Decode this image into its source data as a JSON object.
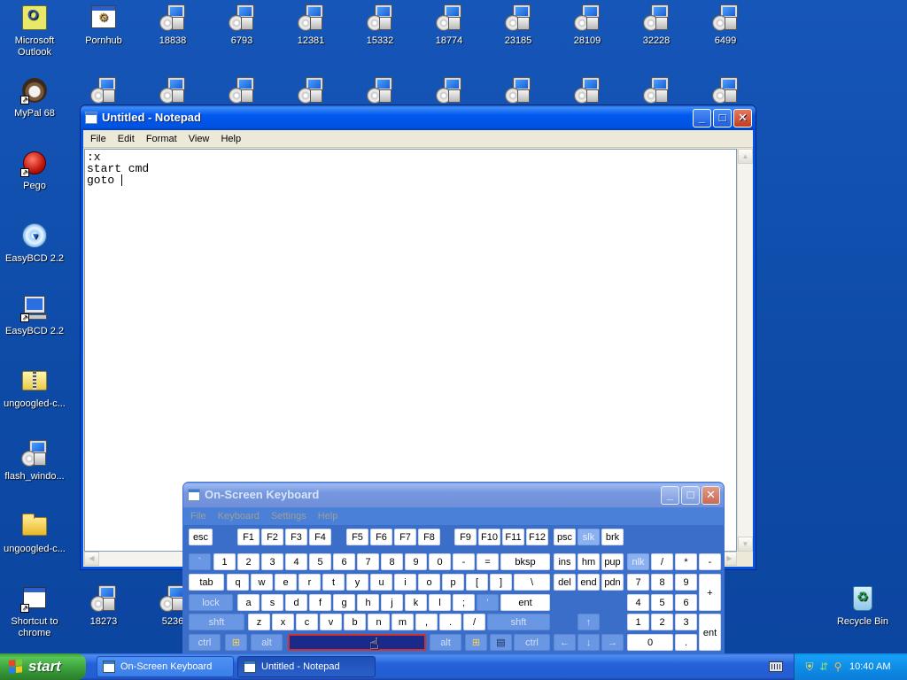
{
  "desktop": {
    "icons_top_row": [
      {
        "label": "Microsoft Outlook",
        "line1": "Microsoft",
        "line2": "Outlook",
        "icon": "outlook-icon"
      },
      {
        "label": "Pornhub",
        "icon": "application-icon"
      },
      {
        "label": "18838",
        "icon": "installer-icon"
      },
      {
        "label": "6793",
        "icon": "installer-icon"
      },
      {
        "label": "12381",
        "icon": "installer-icon"
      },
      {
        "label": "15332",
        "icon": "installer-icon"
      },
      {
        "label": "18774",
        "icon": "installer-icon"
      },
      {
        "label": "23185",
        "icon": "installer-icon"
      },
      {
        "label": "28109",
        "icon": "installer-icon"
      },
      {
        "label": "32228",
        "icon": "installer-icon"
      },
      {
        "label": "6499",
        "icon": "installer-icon"
      }
    ],
    "icons_left_column": [
      {
        "label": "MyPal 68",
        "icon": "mypal-icon"
      },
      {
        "label": "Pego",
        "icon": "pego-icon"
      },
      {
        "label": "EasyBCD 2.2",
        "icon": "easybcd-icon"
      },
      {
        "label": "EasyBCD 2.2",
        "icon": "easybcd-installer-icon"
      },
      {
        "label": "ungoogled-c...",
        "icon": "zip-folder-icon"
      },
      {
        "label": "flash_windo...",
        "icon": "installer-icon"
      },
      {
        "label": "ungoogled-c...",
        "icon": "folder-icon"
      }
    ],
    "icons_bottom_row": [
      {
        "label": "Shortcut to chrome",
        "line1": "Shortcut to",
        "line2": "chrome",
        "icon": "window-shortcut-icon"
      },
      {
        "label": "18273",
        "icon": "installer-icon"
      },
      {
        "label": "5236",
        "icon": "installer-icon"
      }
    ],
    "recycle_bin": {
      "label": "Recycle Bin",
      "icon": "recycle-bin-icon"
    }
  },
  "notepad": {
    "title": "Untitled - Notepad",
    "menu": [
      "File",
      "Edit",
      "Format",
      "View",
      "Help"
    ],
    "text_lines": [
      ":x",
      "start cmd",
      "goto "
    ]
  },
  "osk": {
    "title": "On-Screen Keyboard",
    "menu": [
      "File",
      "Keyboard",
      "Settings",
      "Help"
    ],
    "rows": {
      "fn": [
        "esc",
        "F1",
        "F2",
        "F3",
        "F4",
        "F5",
        "F6",
        "F7",
        "F8",
        "F9",
        "F10",
        "F11",
        "F12",
        "psc",
        "slk",
        "brk"
      ],
      "num": [
        "`",
        "1",
        "2",
        "3",
        "4",
        "5",
        "6",
        "7",
        "8",
        "9",
        "0",
        "-",
        "=",
        "bksp",
        "ins",
        "hm",
        "pup",
        "nlk",
        "/",
        "*",
        "-"
      ],
      "tab": [
        "tab",
        "q",
        "w",
        "e",
        "r",
        "t",
        "y",
        "u",
        "i",
        "o",
        "p",
        "[",
        "]",
        "\\",
        "del",
        "end",
        "pdn",
        "7",
        "8",
        "9",
        "+"
      ],
      "home": [
        "lock",
        "a",
        "s",
        "d",
        "f",
        "g",
        "h",
        "j",
        "k",
        "l",
        ";",
        "'",
        "ent",
        "4",
        "5",
        "6"
      ],
      "shift": [
        "shft",
        "z",
        "x",
        "c",
        "v",
        "b",
        "n",
        "m",
        ",",
        ".",
        "/",
        "shft",
        "↑",
        "1",
        "2",
        "3",
        "ent"
      ],
      "bottom": [
        "ctrl",
        "win",
        "alt",
        "",
        "alt",
        "win",
        "menu",
        "ctrl",
        "←",
        "↓",
        "→",
        "0",
        "."
      ]
    }
  },
  "taskbar": {
    "start_label": "start",
    "tasks": [
      {
        "label": "On-Screen Keyboard",
        "active": false
      },
      {
        "label": "Untitled - Notepad",
        "active": true
      }
    ],
    "clock": "10:40 AM"
  },
  "colors": {
    "desktop": "#0d4aa6",
    "titlebar": "#0058ee",
    "osk_body": "#3a6ec8",
    "start_green": "#3a9d3a",
    "tray": "#0e8ee8"
  }
}
